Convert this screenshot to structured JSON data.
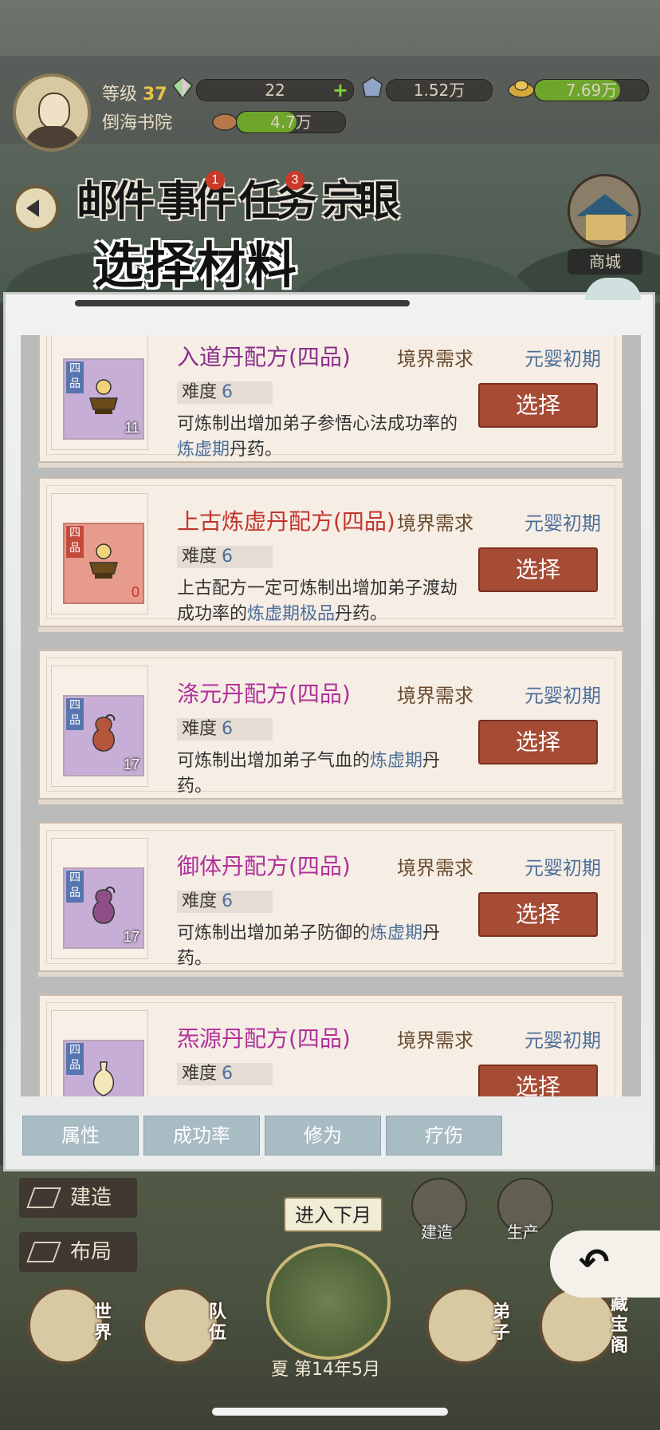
{
  "header": {
    "level_label": "等级",
    "level_value": "37",
    "sect_name": "倒海书院",
    "resources": [
      {
        "name": "gem",
        "value": "22",
        "fill": 0,
        "color": "#6ea52b"
      },
      {
        "name": "stone",
        "value": "1.52万",
        "fill": 0.0,
        "color": "#6ea52b"
      },
      {
        "name": "gold",
        "value": "7.69万",
        "fill": 0.75,
        "color": "#6ea52b"
      },
      {
        "name": "food",
        "value": "4.7万",
        "fill": 0.55,
        "color": "#6ea52b"
      }
    ]
  },
  "tabs": [
    {
      "label": "邮件",
      "badge": ""
    },
    {
      "label": "事件",
      "badge": "1"
    },
    {
      "label": "任务",
      "badge": "3"
    },
    {
      "label": "宗眼",
      "badge": ""
    }
  ],
  "shop_label": "商城",
  "modal": {
    "title": "选择材料",
    "select_label": "选择",
    "difficulty_label": "难度",
    "requirement_label": "境界需求",
    "items": [
      {
        "name": "入道丹配方(四品)",
        "name_color": "#8a2f8a",
        "grade": "四品",
        "count": "11",
        "requirement": "元婴初期",
        "difficulty": "6",
        "desc_a": "可炼制出增加弟子参悟心法成功率的",
        "desc_hl": "炼虚期",
        "desc_b": "丹药。"
      },
      {
        "name": "上古炼虚丹配方(四品)",
        "name_color": "#c2352c",
        "grade": "四品",
        "count": "0",
        "requirement": "元婴初期",
        "difficulty": "6",
        "desc_a": "上古配方一定可炼制出增加弟子渡劫成功率的",
        "desc_hl": "炼虚期极品",
        "desc_b": "丹药。"
      },
      {
        "name": "涤元丹配方(四品)",
        "name_color": "#b0309a",
        "grade": "四品",
        "count": "17",
        "requirement": "元婴初期",
        "difficulty": "6",
        "desc_a": "可炼制出增加弟子气血的",
        "desc_hl": "炼虚期",
        "desc_b": "丹药。"
      },
      {
        "name": "御体丹配方(四品)",
        "name_color": "#b0309a",
        "grade": "四品",
        "count": "17",
        "requirement": "元婴初期",
        "difficulty": "6",
        "desc_a": "可炼制出增加弟子防御的",
        "desc_hl": "炼虚期",
        "desc_b": "丹药。"
      },
      {
        "name": "炁源丹配方(四品)",
        "name_color": "#b0309a",
        "grade": "四品",
        "count": "",
        "requirement": "元婴初期",
        "difficulty": "6",
        "desc_a": "",
        "desc_hl": "",
        "desc_b": ""
      }
    ],
    "filters": [
      "属性",
      "成功率",
      "修为",
      "疗伤"
    ]
  },
  "bottom": {
    "build_label": "建造",
    "layout_label": "布局",
    "next_month": "进入下月",
    "season": "夏",
    "date": "第14年5月",
    "icon_build": "建造",
    "icon_produce": "生产",
    "world": "世界",
    "team": "队伍",
    "disciple": "弟子",
    "treasure": "藏宝阁"
  }
}
